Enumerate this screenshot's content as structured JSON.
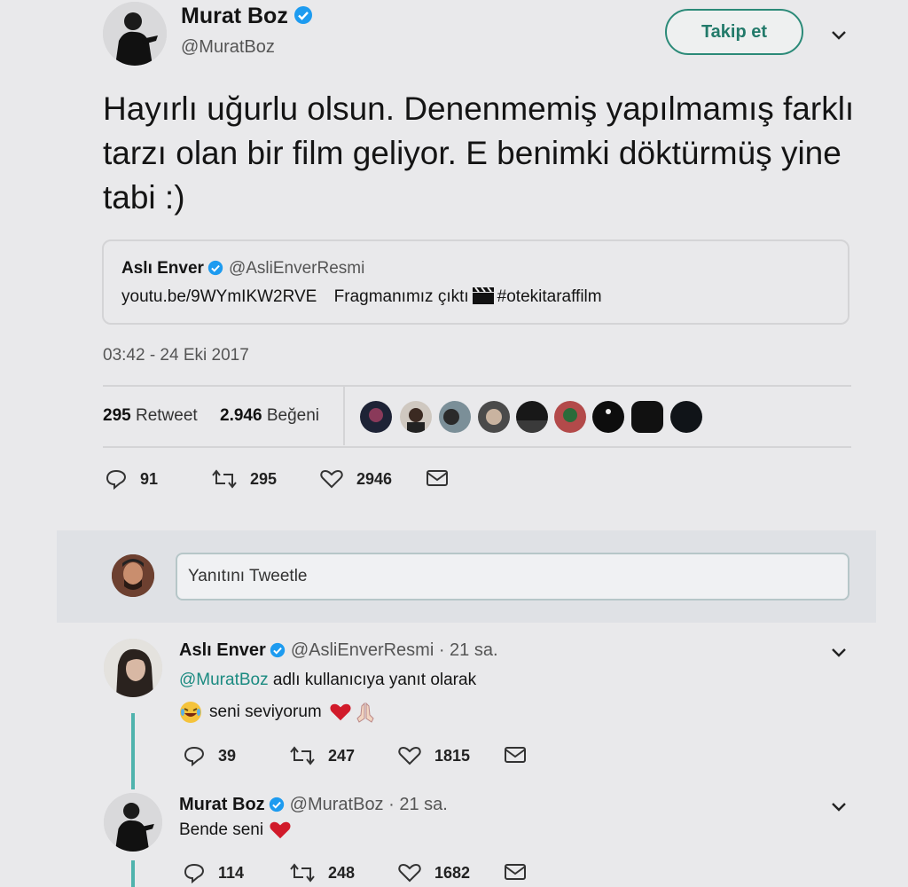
{
  "main_tweet": {
    "author_name": "Murat Boz",
    "author_handle": "@MuratBoz",
    "follow_label": "Takip et",
    "text": "Hayırlı uğurlu olsun. Denenmemiş yapılmamış farklı tarzı olan bir film geliyor. E benimki döktürmüş yine tabi :)",
    "timestamp": "03:42 - 24 Eki 2017"
  },
  "quoted_tweet": {
    "author_name": "Aslı Enver",
    "author_handle": "@AsliEnverResmi",
    "link": "youtu.be/9WYmIKW2RVE",
    "text": "Fragmanımız çıktı",
    "hashtag": "#otekitaraffilm"
  },
  "stats": {
    "retweets_count": "295",
    "retweets_label": "Retweet",
    "likes_count": "2.946",
    "likes_label": "Beğeni"
  },
  "actions": {
    "replies": "91",
    "retweets": "295",
    "likes": "2946"
  },
  "reply_box": {
    "placeholder": "Yanıtını Tweetle"
  },
  "replies": [
    {
      "author_name": "Aslı Enver",
      "meta": "@AsliEnverResmi · 21 sa.",
      "reply_to_mention": "@MuratBoz",
      "reply_to_suffix": "adlı kullanıcıya yanıt olarak",
      "text": "seni seviyorum",
      "replies": "39",
      "retweets": "247",
      "likes": "1815"
    },
    {
      "author_name": "Murat Boz",
      "meta": "@MuratBoz · 21 sa.",
      "text": "Bende seni",
      "replies": "114",
      "retweets": "248",
      "likes": "1682"
    }
  ],
  "colors": {
    "accent": "#1a8a80",
    "verified": "#1d9bf0",
    "heart": "#d11a2a"
  }
}
